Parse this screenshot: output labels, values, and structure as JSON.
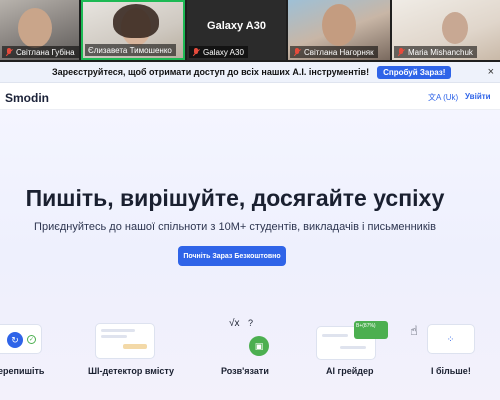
{
  "participants": [
    {
      "name": "Світлана Губіна",
      "muted": true
    },
    {
      "name": "Єлизавета Тимошенко",
      "muted": false
    },
    {
      "name": "Galaxy A30",
      "muted": true,
      "display": "Galaxy A30"
    },
    {
      "name": "Світлана Нагорняк",
      "muted": true
    },
    {
      "name": "Maria Mishanchuk",
      "muted": true
    }
  ],
  "banner": {
    "message": "Зареєструйтеся, щоб отримати доступ до всіх наших A.I. інструментів!",
    "cta": "Спробуй Зараз!",
    "close": "×"
  },
  "nav": {
    "logo": "Smodin",
    "language": "文A (Uk)",
    "login": "Увійти"
  },
  "hero": {
    "title": "Пишіть, вирішуйте, досягайте успіху",
    "subtitle": "Приєднуйтесь до нашої спільноти з 10M+ студентів, викладачів і письменників",
    "cta": "Почніть Зараз Безкоштовно"
  },
  "features": [
    {
      "label": "ерепишіть"
    },
    {
      "label": "ШІ-детектор вмісту"
    },
    {
      "label": "Розв'язати",
      "math": "√x",
      "q": "?"
    },
    {
      "label": "AI грейдер",
      "grade": "B+(87%)"
    },
    {
      "label": "І більше!"
    }
  ],
  "colors": {
    "accent": "#2f64e8",
    "speaking": "#1db954",
    "muted": "#e64b3c"
  }
}
